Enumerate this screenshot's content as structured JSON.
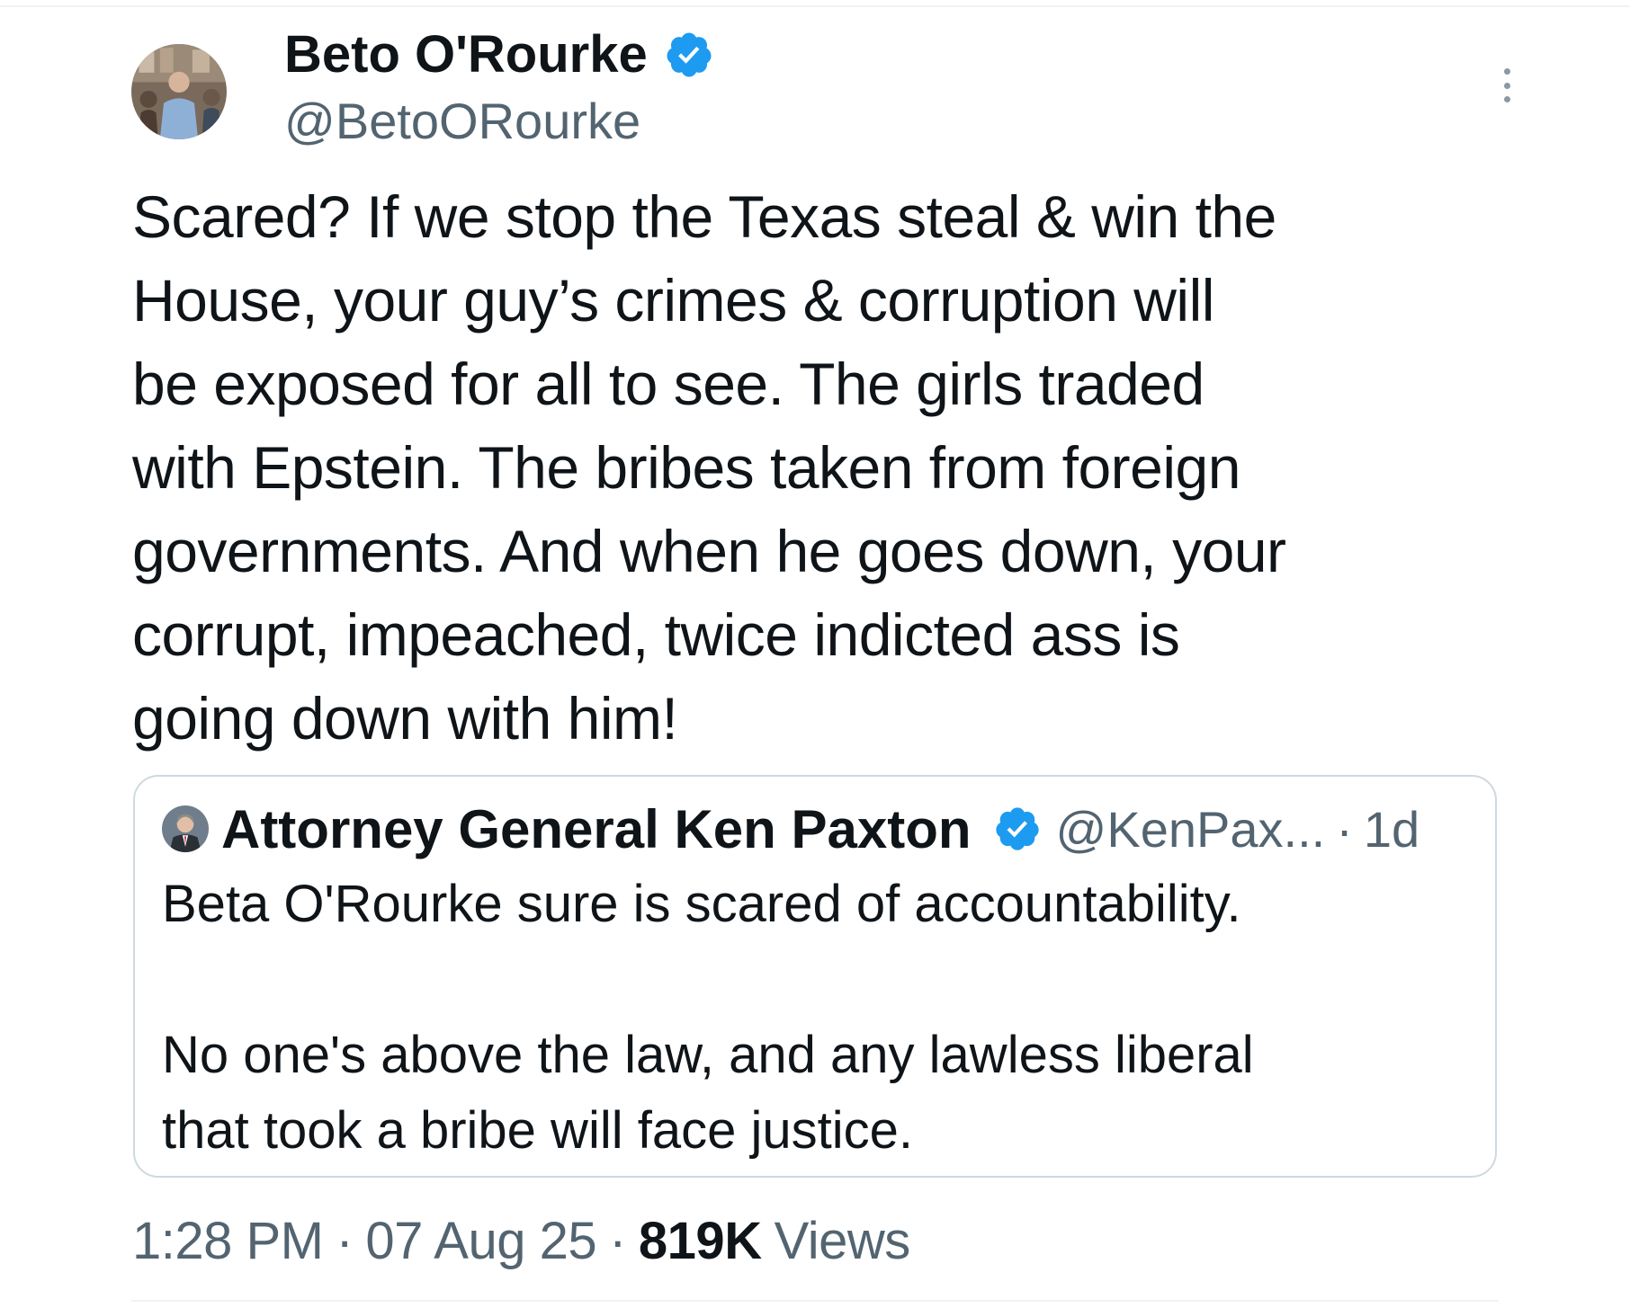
{
  "tweet": {
    "author": {
      "name": "Beto O'Rourke",
      "handle": "@BetoORourke",
      "verified": true
    },
    "text_lines": [
      "Scared? If we stop the Texas steal & win the",
      "House, your guy’s crimes & corruption will",
      "be exposed for all to see. The girls traded",
      "with Epstein. The bribes taken from foreign",
      "governments. And when he goes down, your",
      "corrupt, impeached, twice indicted ass is",
      "going down with him!"
    ],
    "quoted": {
      "name": "Attorney General Ken Paxton",
      "handle": "@KenPax...",
      "separator": "·",
      "time": "1d",
      "verified": true,
      "paragraph1": "Beta O'Rourke sure is scared of accountability.",
      "paragraph2_lines": [
        "No one's above the law, and any lawless liberal",
        "that took a bribe will face justice."
      ]
    },
    "meta": {
      "time": "1:28 PM",
      "date": "07 Aug 25",
      "separator": "·",
      "views_count": "819K",
      "views_label": "Views"
    }
  },
  "colors": {
    "text": "#0f1419",
    "secondary": "#536471",
    "verified_blue": "#1d9bf0",
    "border": "#cfd9de"
  },
  "icons": {
    "verified": "verified-badge-icon",
    "more": "more-options-icon"
  }
}
